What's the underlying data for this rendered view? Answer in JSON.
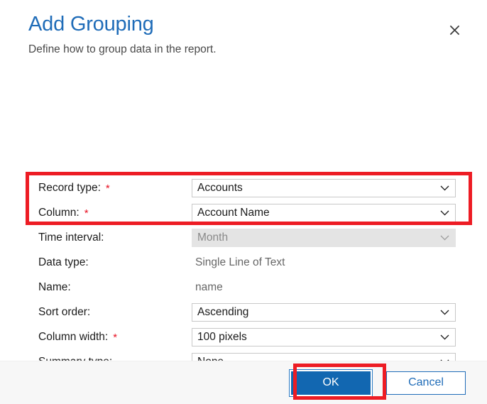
{
  "dialog": {
    "title": "Add Grouping",
    "subtitle": "Define how to group data in the report.",
    "close_icon": "close-icon"
  },
  "form": {
    "rows": [
      {
        "label": "Record type:",
        "required": true,
        "control": "combobox",
        "value": "Accounts",
        "disabled": false
      },
      {
        "label": "Column:",
        "required": true,
        "control": "combobox",
        "value": "Account Name",
        "disabled": false
      },
      {
        "label": "Time interval:",
        "required": false,
        "control": "combobox",
        "value": "Month",
        "disabled": true
      },
      {
        "label": "Data type:",
        "required": false,
        "control": "static",
        "value": "Single Line of Text",
        "disabled": false
      },
      {
        "label": "Name:",
        "required": false,
        "control": "static",
        "value": "name",
        "disabled": false
      },
      {
        "label": "Sort order:",
        "required": false,
        "control": "combobox",
        "value": "Ascending",
        "disabled": false
      },
      {
        "label": "Column width:",
        "required": true,
        "control": "combobox",
        "value": "100 pixels",
        "disabled": false
      },
      {
        "label": "Summary type:",
        "required": false,
        "control": "combobox",
        "value": "None",
        "disabled": false
      }
    ],
    "required_marker": "*"
  },
  "footer": {
    "ok_label": "OK",
    "cancel_label": "Cancel"
  },
  "annotations": [
    {
      "name": "required-fields-highlight",
      "color": "#ed1c24"
    },
    {
      "name": "ok-button-highlight",
      "color": "#ed1c24"
    }
  ],
  "colors": {
    "title_blue": "#1f6cb8",
    "primary_button": "#1267b1",
    "required_red": "#e81123",
    "annotation_red": "#ed1c24",
    "footer_bg": "#f7f7f7",
    "disabled_bg": "#e4e4e4"
  }
}
